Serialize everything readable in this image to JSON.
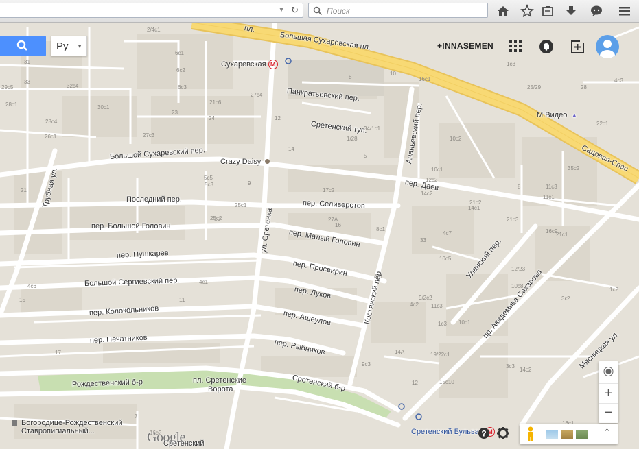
{
  "browser": {
    "search_placeholder": "Поиск"
  },
  "map_ui": {
    "language": "Ру",
    "user_name": "+INNASEMEN",
    "zoom_in": "+",
    "zoom_out": "−",
    "logo": "Google",
    "colors": {
      "search_button": "#4d90fe",
      "highway": "#f8d974",
      "park": "#c8dfb1",
      "road": "#ffffff",
      "block": "#e0dbd1"
    }
  },
  "streets": {
    "bolshaya_sukharevskaya_pl": "Большая Сухаревская пл.",
    "pl_top": "пл.",
    "sadovaya": "Садовая-Спас",
    "pankratevsky": "Панкратьевский пер.",
    "sretensky_tup": "Сретенский туп.",
    "bolshoy_sukharevsky": "Большой Сухаревский пер.",
    "posledny": "Последний пер.",
    "bolshoy_golovin": "пер. Большой Головин",
    "pushkarev": "пер. Пушкарев",
    "bolshoy_sergievsky": "Большой Сергиевский пер.",
    "kolokolnikov": "пер. Колокольников",
    "pechatnikov": "пер. Печатников",
    "rozhdestvensky_b": "Рождественский б-р",
    "sretenskie_vorota_1": "пл. Сретенские",
    "sretenskie_vorota_2": "Ворота",
    "sretensky_b": "Сретенский б-р",
    "seliverstov": "пер. Селиверстов",
    "maly_golovin": "пер. Малый Головин",
    "prosvirin": "пер. Просвирин",
    "lukov": "пер. Луков",
    "ashcheulov": "пер. Ащеулов",
    "rybnikov": "пер. Рыбников",
    "sretenka": "ул. Сретенка",
    "kostyansky": "Костянский пер",
    "ananevsky": "Ананьевский пер.",
    "daev": "пер. Даев",
    "ulansky": "Уланский пер.",
    "sakharova": "пр. Академика Сахарова",
    "myasnitskaya": "Мясницкая ул.",
    "trubnaya": "Трубная ул.",
    "sretensky_bottom": "Сретенский"
  },
  "pois": {
    "sukharevskaya": "Сухаревская",
    "crazy_daisy": "Crazy Daisy",
    "mvideo": "М.Видео",
    "bogoroditse_1": "Богородице-Рождественский",
    "bogoroditse_2": "Ставропигиальный...",
    "sretensky_bulvar": "Сретенский Бульвар"
  },
  "house_numbers": [
    "2/4с1",
    "6с1",
    "6с2",
    "6с3",
    "31",
    "33",
    "32с4",
    "29с5",
    "30с1",
    "28с1",
    "28с4",
    "26с1",
    "27с3",
    "27с4",
    "21с6",
    "24",
    "23",
    "1с3",
    "4с3",
    "16с1",
    "8",
    "10",
    "12",
    "14",
    "34/1с1",
    "1/28",
    "5",
    "9",
    "5с5",
    "5с3",
    "19",
    "25с1",
    "25с2",
    "21",
    "17с2",
    "27А",
    "16",
    "10с2",
    "12с2",
    "14с1",
    "14с2",
    "10с1",
    "8",
    "11с3",
    "11с1",
    "16с9",
    "21с2",
    "21с3",
    "21с1",
    "22с1",
    "25/29",
    "28",
    "33",
    "35с2",
    "3к2",
    "1с2",
    "4с7",
    "10с5",
    "12/23",
    "4с6",
    "1с3",
    "11с3",
    "15с10",
    "10с8",
    "14А",
    "12",
    "4с1",
    "11",
    "17",
    "15",
    "19/22с1",
    "9с3",
    "4с2",
    "4с1",
    "8с1",
    "9/2с2",
    "7",
    "16с2",
    "16с1",
    "10с1",
    "14с2",
    "3с3"
  ]
}
